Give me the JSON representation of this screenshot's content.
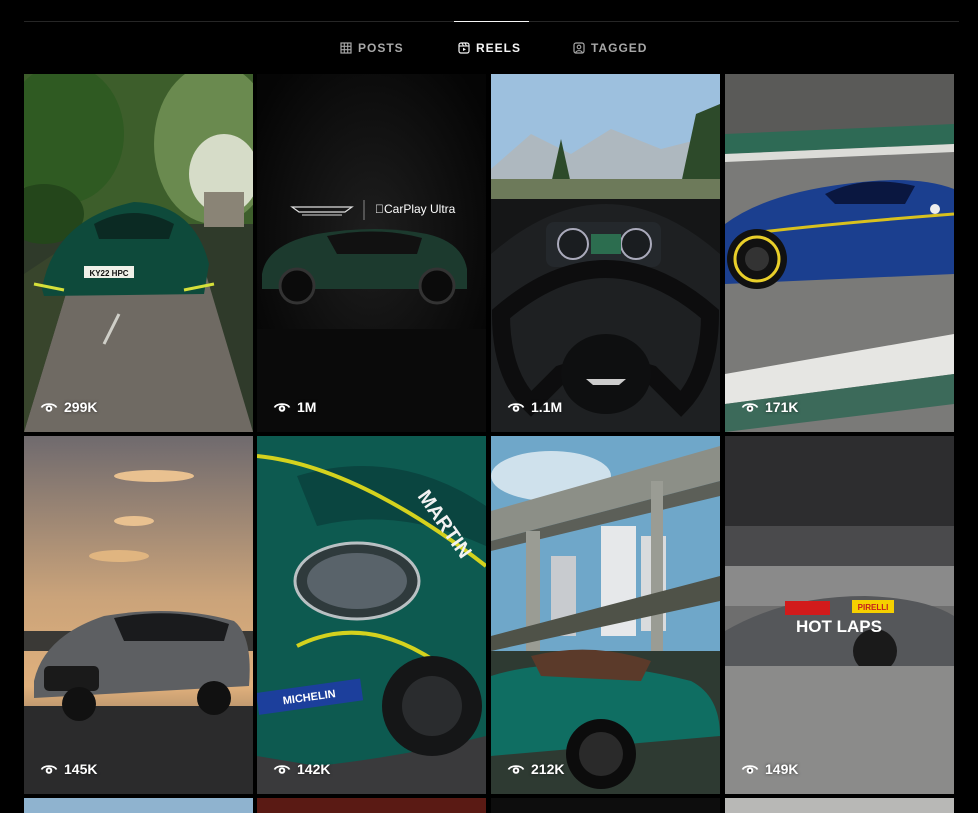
{
  "tabs": [
    {
      "label": "POSTS",
      "icon": "grid-icon",
      "active": false
    },
    {
      "label": "REELS",
      "icon": "reels-icon",
      "active": true
    },
    {
      "label": "TAGGED",
      "icon": "tagged-icon",
      "active": false
    }
  ],
  "reels": [
    {
      "views": "299K",
      "plate": "KY22 HPC"
    },
    {
      "views": "1M",
      "brand": "CarPlay Ultra"
    },
    {
      "views": "1.1M"
    },
    {
      "views": "171K"
    },
    {
      "views": "145K"
    },
    {
      "views": "142K",
      "sponsor": "MICHELIN",
      "livery": "MARTIN"
    },
    {
      "views": "212K"
    },
    {
      "views": "149K",
      "title": "HOT LAPS",
      "sponsor": "PIRELLI"
    }
  ],
  "colors": {
    "accent": "#0d5e4c",
    "background": "#000000",
    "tab_inactive": "#a8a8a8"
  }
}
